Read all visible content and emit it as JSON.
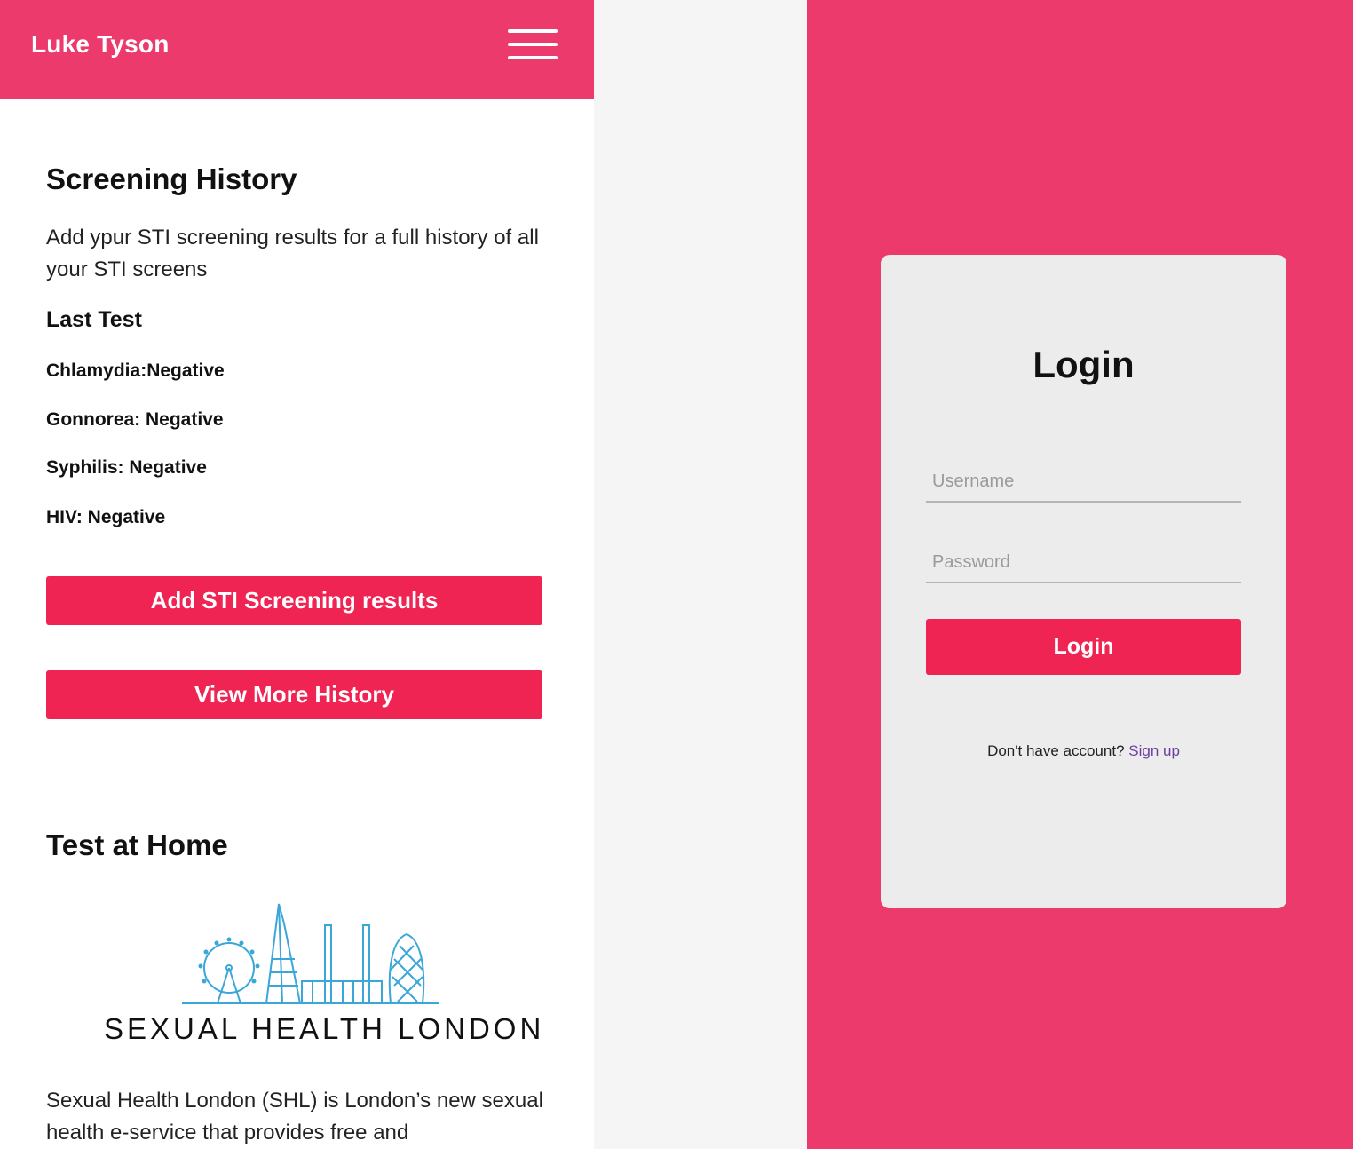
{
  "header": {
    "user_name": "Luke Tyson",
    "menu_icon": "hamburger-menu-icon"
  },
  "screening": {
    "title": "Screening History",
    "description": "Add ypur STI screening results for a full history of all your STI screens",
    "last_test_label": "Last Test",
    "results": [
      "Chlamydia:Negative",
      "Gonnorea: Negative",
      "Syphilis: Negative",
      "HIV: Negative"
    ],
    "add_button_label": "Add STI Screening results",
    "view_more_button_label": "View More History"
  },
  "test_at_home": {
    "title": "Test at Home",
    "logo_text": "SEXUAL HEALTH LONDON",
    "description": "Sexual Health London (SHL) is London’s new sexual health e-service that provides free and"
  },
  "login": {
    "title": "Login",
    "username_placeholder": "Username",
    "password_placeholder": "Password",
    "button_label": "Login",
    "no_account_text": "Don't have account?",
    "signup_link": "Sign up"
  },
  "colors": {
    "brand_pink": "#ec3a6d",
    "button_red": "#ef2452",
    "link_purple": "#6b3fa0",
    "card_bg": "#ececec"
  }
}
